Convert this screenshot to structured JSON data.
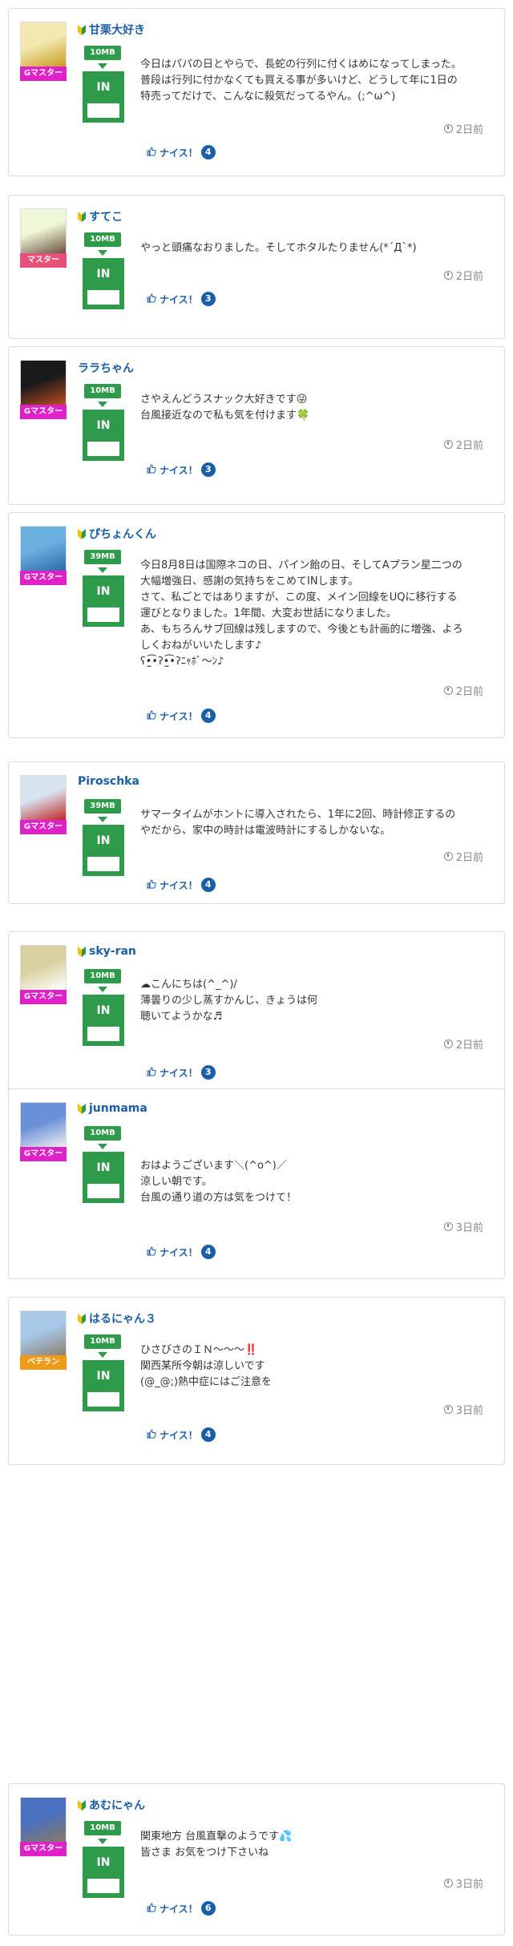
{
  "colors": {
    "accent_green": "#2e9b4a",
    "link_blue": "#1a5ea8",
    "badge_g_master": "#e020c8",
    "badge_master": "#e8507a",
    "badge_veteran": "#f09a1a"
  },
  "icons": {
    "leaf": "beginner-leaf-icon",
    "clock": "clock-icon",
    "like": "thumbs-up-icon"
  },
  "posts": [
    {
      "name": "甘栗大好き",
      "leaf": true,
      "badge": "Gマスター",
      "badge_color": "#e020c8",
      "avatar_colors": [
        "#f3e8b0",
        "#c89a20"
      ],
      "mb": "10MB",
      "in": "IN",
      "message": "今日はパパの日とやらで、長蛇の行列に付くはめになってしまった。\n普段は行列に付かなくても買える事が多いけど、どうして年に1日の\n特売ってだけで、こんなに殺気だってるやん。(;^ω^)",
      "time": "2日前",
      "nice_label": "ナイス！",
      "nice_count": "4"
    },
    {
      "name": "すてこ",
      "leaf": true,
      "badge": "マスター",
      "badge_color": "#e8507a",
      "avatar_colors": [
        "#eef7d8",
        "#6a4a3a"
      ],
      "mb": "10MB",
      "in": "IN",
      "message": "やっと頭痛なおりました。そしてホタルたりません(*´Д`*)",
      "time": "2日前",
      "nice_label": "ナイス！",
      "nice_count": "3"
    },
    {
      "name": "ララちゃん",
      "leaf": false,
      "badge": "Gマスター",
      "badge_color": "#e020c8",
      "avatar_colors": [
        "#1a1a1a",
        "#c05020"
      ],
      "mb": "10MB",
      "in": "IN",
      "message": "さやえんどうスナック大好きです😜\n台風接近なので私も気を付けます🍀",
      "time": "2日前",
      "nice_label": "ナイス！",
      "nice_count": "3"
    },
    {
      "name": "ぴちょんくん",
      "leaf": true,
      "badge": "Gマスター",
      "badge_color": "#e020c8",
      "avatar_colors": [
        "#6ab0e0",
        "#2a6aa8"
      ],
      "mb": "39MB",
      "in": "IN",
      "message": "今日8月8日は国際ネコの日、パイン飴の日、そしてAプラン星二つの\n大幅増強日、感謝の気持ちをこめてINします。\nさて、私ごとではありますが、この度、メイン回線をUQに移行する\n運びとなりました。1年間、大変お世話になりました。\nあ、もちろんサブ回線は残しますので、今後とも計画的に増強、よろ\nしくおねがいいたします♪\nʕ•̫͡•ʔ•̫͡•ʔﾆｬﾎﾞ～ﾝ♪",
      "time": "2日前",
      "nice_label": "ナイス！",
      "nice_count": "4"
    },
    {
      "name": "Piroschka",
      "leaf": false,
      "badge": "Gマスター",
      "badge_color": "#e020c8",
      "avatar_colors": [
        "#d8e4f0",
        "#c02020"
      ],
      "mb": "39MB",
      "in": "IN",
      "message": "サマータイムがホントに導入されたら、1年に2回、時計修正するの\nやだから、家中の時計は電波時計にするしかないな。",
      "time": "2日前",
      "nice_label": "ナイス！",
      "nice_count": "4"
    },
    {
      "name": "sky-ran",
      "leaf": true,
      "badge": "Gマスター",
      "badge_color": "#e020c8",
      "avatar_colors": [
        "#d8d0a0",
        "#ffffff"
      ],
      "mb": "10MB",
      "in": "IN",
      "message": "☁こんにちは(^_^)/\n薄曇りの少し蒸すかんじ、きょうは何\n聴いてようかな♬",
      "time": "2日前",
      "nice_label": "ナイス！",
      "nice_count": "3"
    },
    {
      "name": "junmama",
      "leaf": true,
      "badge": "Gマスター",
      "badge_color": "#e020c8",
      "avatar_colors": [
        "#6a90d8",
        "#f0f0f0"
      ],
      "mb": "10MB",
      "in": "IN",
      "message": "おはようございます＼(^o^)／\n涼しい朝です。\n台風の通り道の方は気をつけて！",
      "time": "3日前",
      "nice_label": "ナイス！",
      "nice_count": "4"
    },
    {
      "name": "はるにゃん３",
      "leaf": true,
      "badge": "ベテラン",
      "badge_color": "#f09a1a",
      "avatar_colors": [
        "#a8c8e8",
        "#8a8070"
      ],
      "mb": "10MB",
      "in": "IN",
      "message": "ひさびさのＩＮ〜〜〜‼️\n関西某所今朝は涼しいです\n(@_@;)熱中症にはご注意を",
      "time": "3日前",
      "nice_label": "ナイス！",
      "nice_count": "4"
    },
    {
      "name": "あむにゃん",
      "leaf": true,
      "badge": "Gマスター",
      "badge_color": "#e020c8",
      "avatar_colors": [
        "#4a70c0",
        "#8a7a60"
      ],
      "mb": "10MB",
      "in": "IN",
      "message": "関東地方 台風直撃のようです💦\n皆さま お気をつけ下さいね",
      "time": "3日前",
      "nice_label": "ナイス！",
      "nice_count": "6"
    }
  ]
}
